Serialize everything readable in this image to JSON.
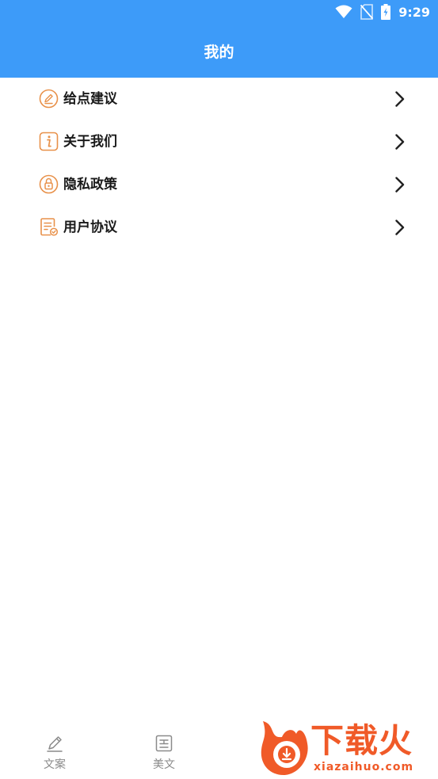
{
  "status_bar": {
    "time": "9:29",
    "icons": [
      "wifi-icon",
      "no-sim-icon",
      "battery-charging-icon"
    ]
  },
  "header": {
    "title": "我的"
  },
  "menu": {
    "items": [
      {
        "label": "给点建议",
        "icon": "feedback-edit-icon"
      },
      {
        "label": "关于我们",
        "icon": "info-icon"
      },
      {
        "label": "隐私政策",
        "icon": "privacy-lock-icon"
      },
      {
        "label": "用户协议",
        "icon": "agreement-doc-icon"
      }
    ],
    "chevron_icon": "chevron-right-icon"
  },
  "bottom_nav": {
    "items": [
      {
        "label": "文案",
        "icon": "pen-icon"
      },
      {
        "label": "美文",
        "icon": "article-icon"
      }
    ]
  },
  "watermark": {
    "title": "下载火",
    "subtitle": "xiazaihuo.com"
  },
  "colors": {
    "header_bg": "#3d9bf9",
    "icon_accent": "#e8914a",
    "watermark": "#f05a28",
    "nav_text": "#8a8a8a"
  }
}
